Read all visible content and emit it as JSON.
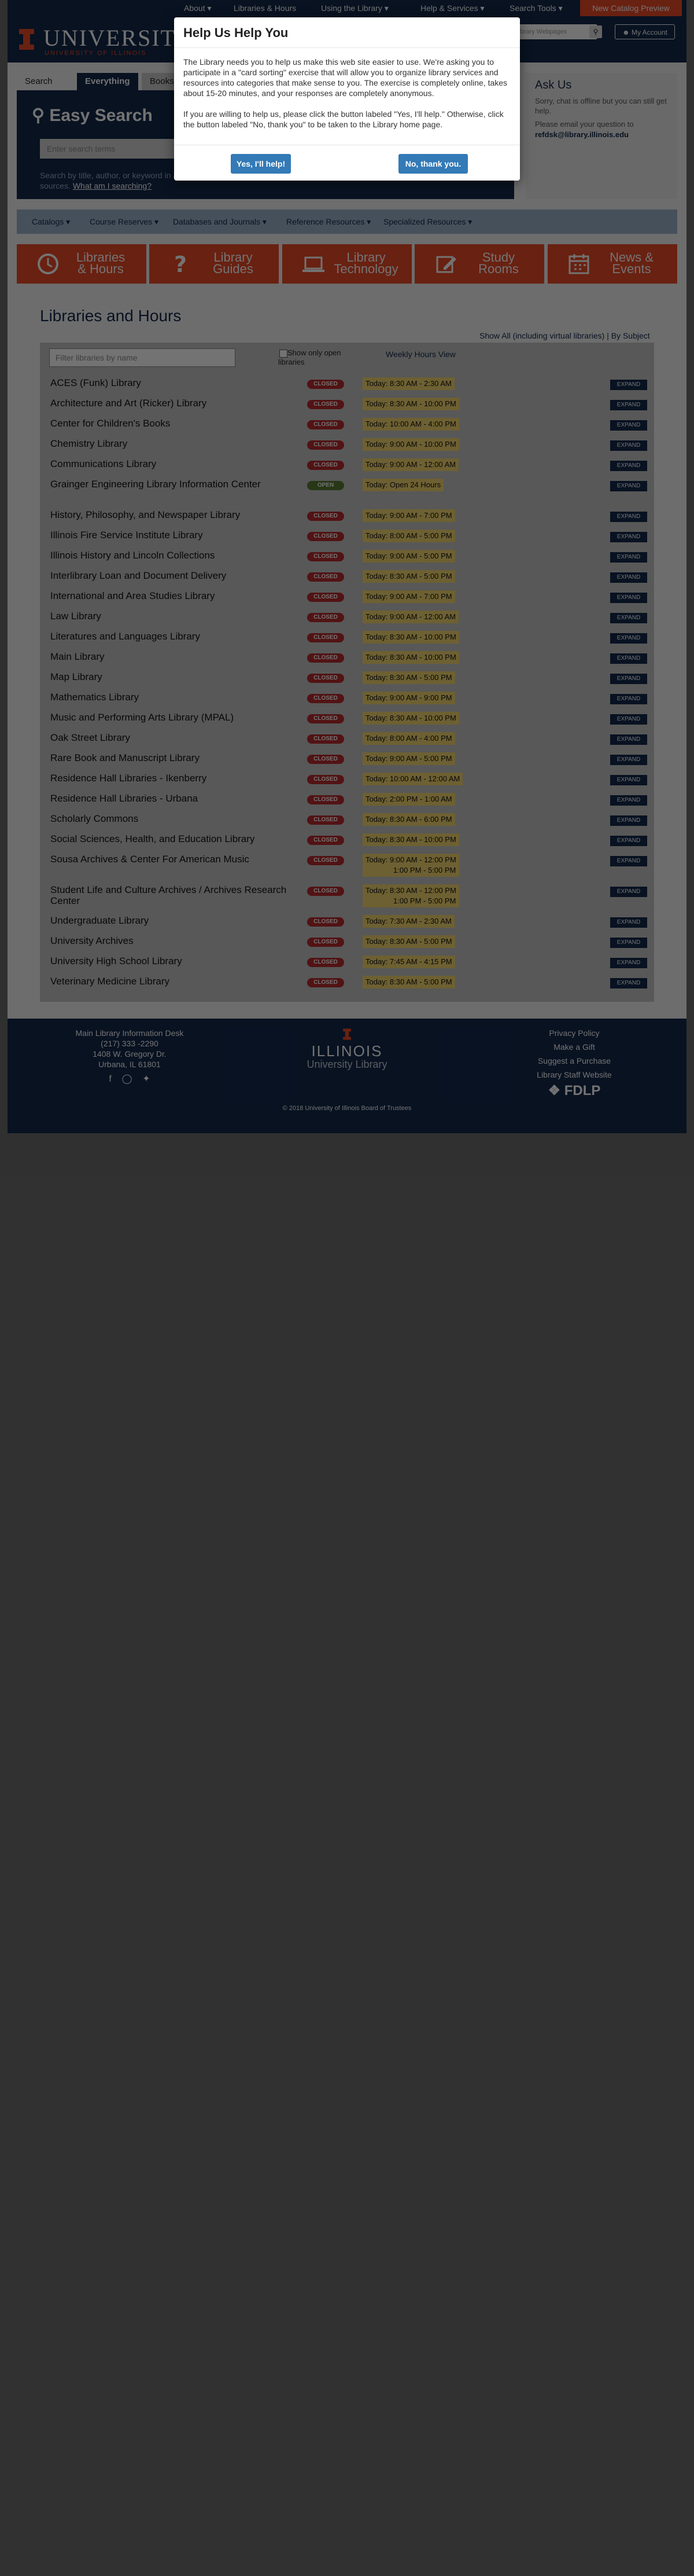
{
  "topnav": {
    "items": [
      "About ▾",
      "Libraries & Hours",
      "Using the Library ▾",
      "Help & Services ▾",
      "Search Tools ▾"
    ],
    "preview_label": "New Catalog Preview"
  },
  "header": {
    "logo_text": "UNIVERSITY",
    "logo_sub": "UNIVERSITY OF ILLINOIS",
    "search_placeholder": "Library Webpages",
    "account_label": "My Account"
  },
  "search": {
    "label": "Search for",
    "tabs": [
      "Everything",
      "Books"
    ],
    "title": "Easy Search",
    "input_placeholder": "Enter search terms",
    "help_text": "Search by title, author, or keyword in a variety of",
    "help_text2": "sources.",
    "help_link": "What am I searching?"
  },
  "askus": {
    "title": "Ask Us",
    "status": "Sorry, chat is offline but you can still get help.",
    "email_text": "Please email your question to",
    "email": "refdsk@library.illinois.edu"
  },
  "catbar": {
    "items": [
      "Catalogs ▾",
      "Course Reserves ▾",
      "Databases and Journals ▾",
      "Reference Resources ▾",
      "Specialized Resources ▾"
    ]
  },
  "tiles": [
    {
      "label1": "Libraries",
      "label2": "& Hours",
      "icon": "clock-icon"
    },
    {
      "label1": "Library",
      "label2": "Guides",
      "icon": "question-icon"
    },
    {
      "label1": "Library",
      "label2": "Technology",
      "icon": "laptop-icon"
    },
    {
      "label1": "Study",
      "label2": "Rooms",
      "icon": "pencil-icon"
    },
    {
      "label1": "News &",
      "label2": "Events",
      "icon": "calendar-icon"
    }
  ],
  "libraries": {
    "title": "Libraries and Hours",
    "show_all": "Show All (including virtual libraries)",
    "by_subject": "By Subject",
    "filter_placeholder": "Filter libraries by name",
    "show_open_label": "Show only open libraries",
    "weekly_link": "Weekly Hours View",
    "expand_label": "EXPAND",
    "rows": [
      {
        "name": "ACES (Funk) Library",
        "status": "CLOSED",
        "hours": "Today: 8:30 AM - 2:30 AM"
      },
      {
        "name": "Architecture and Art (Ricker) Library",
        "status": "CLOSED",
        "hours": "Today: 8:30 AM - 10:00 PM"
      },
      {
        "name": "Center for Children's Books",
        "status": "CLOSED",
        "hours": "Today: 10:00 AM - 4:00 PM"
      },
      {
        "name": "Chemistry Library",
        "status": "CLOSED",
        "hours": "Today: 9:00 AM - 10:00 PM"
      },
      {
        "name": "Communications Library",
        "status": "CLOSED",
        "hours": "Today: 9:00 AM - 12:00 AM"
      },
      {
        "name": "Grainger Engineering Library Information Center",
        "status": "OPEN",
        "hours": "Today: Open 24 Hours"
      },
      {
        "name": "History, Philosophy, and Newspaper Library",
        "status": "CLOSED",
        "hours": "Today: 9:00 AM - 7:00 PM"
      },
      {
        "name": "Illinois Fire Service Institute Library",
        "status": "CLOSED",
        "hours": "Today: 8:00 AM - 5:00 PM"
      },
      {
        "name": "Illinois History and Lincoln Collections",
        "status": "CLOSED",
        "hours": "Today: 9:00 AM - 5:00 PM"
      },
      {
        "name": "Interlibrary Loan and Document Delivery",
        "status": "CLOSED",
        "hours": "Today: 8:30 AM - 5:00 PM"
      },
      {
        "name": "International and Area Studies Library",
        "status": "CLOSED",
        "hours": "Today: 9:00 AM - 7:00 PM"
      },
      {
        "name": "Law Library",
        "status": "CLOSED",
        "hours": "Today: 9:00 AM - 12:00 AM"
      },
      {
        "name": "Literatures and Languages Library",
        "status": "CLOSED",
        "hours": "Today: 8:30 AM - 10:00 PM"
      },
      {
        "name": "Main Library",
        "status": "CLOSED",
        "hours": "Today: 8:30 AM - 10:00 PM"
      },
      {
        "name": "Map Library",
        "status": "CLOSED",
        "hours": "Today: 8:30 AM - 5:00 PM"
      },
      {
        "name": "Mathematics Library",
        "status": "CLOSED",
        "hours": "Today: 9:00 AM - 9:00 PM"
      },
      {
        "name": "Music and Performing Arts Library (MPAL)",
        "status": "CLOSED",
        "hours": "Today: 8:30 AM - 10:00 PM"
      },
      {
        "name": "Oak Street Library",
        "status": "CLOSED",
        "hours": "Today: 8:00 AM - 4:00 PM"
      },
      {
        "name": "Rare Book and Manuscript Library",
        "status": "CLOSED",
        "hours": "Today: 9:00 AM - 5:00 PM"
      },
      {
        "name": "Residence Hall Libraries - Ikenberry",
        "status": "CLOSED",
        "hours": "Today: 10:00 AM - 12:00 AM"
      },
      {
        "name": "Residence Hall Libraries - Urbana",
        "status": "CLOSED",
        "hours": "Today: 2:00 PM - 1:00 AM"
      },
      {
        "name": "Scholarly Commons",
        "status": "CLOSED",
        "hours": "Today: 8:30 AM - 6:00 PM"
      },
      {
        "name": "Social Sciences, Health, and Education Library",
        "status": "CLOSED",
        "hours": "Today: 8:30 AM - 10:00 PM"
      },
      {
        "name": "Sousa Archives & Center For American Music",
        "status": "CLOSED",
        "hours": "Today: 9:00 AM - 12:00 PM",
        "hours2": "1:00 PM - 5:00 PM"
      },
      {
        "name": "Student Life and Culture Archives / Archives Research Center",
        "status": "CLOSED",
        "hours": "Today: 8:30 AM - 12:00 PM",
        "hours2": "1:00 PM - 5:00 PM"
      },
      {
        "name": "Undergraduate Library",
        "status": "CLOSED",
        "hours": "Today: 7:30 AM - 2:30 AM"
      },
      {
        "name": "University Archives",
        "status": "CLOSED",
        "hours": "Today: 8:30 AM - 5:00 PM"
      },
      {
        "name": "University High School Library",
        "status": "CLOSED",
        "hours": "Today: 7:45 AM - 4:15 PM"
      },
      {
        "name": "Veterinary Medicine Library",
        "status": "CLOSED",
        "hours": "Today: 8:30 AM - 5:00 PM"
      }
    ]
  },
  "footer": {
    "contact": [
      "Main Library Information Desk",
      "(217) 333 -2290",
      "1408 W. Gregory Dr.",
      "Urbana, IL 61801"
    ],
    "brand": "ILLINOIS",
    "brand_sub": "University Library",
    "links": [
      "Privacy Policy",
      "Make a Gift",
      "Suggest a Purchase",
      "Library Staff Website"
    ],
    "fdlp": "FDLP",
    "copyright": "© 2018 University of Illinois Board of Trustees"
  },
  "modal": {
    "title": "Help Us Help You",
    "para1": "The Library needs you to help us make this web site easier to use. We're asking you to participate in a \"card sorting\" exercise that will allow you to organize library services and resources into categories that make sense to you. The exercise is completely online, takes about 15-20 minutes, and your responses are completely anonymous.",
    "para2": "If you are willing to help us, please click the button labeled \"Yes, I'll help.\" Otherwise, click the button labeled \"No, thank you\" to be taken to the Library home page.",
    "yes_label": "Yes, I'll help!",
    "no_label": "No, thank you."
  },
  "colors": {
    "navy": "#13294b",
    "orange": "#e84a27",
    "closed": "#b62b2e",
    "open": "#5a7a32",
    "hours": "#f2d46f"
  }
}
